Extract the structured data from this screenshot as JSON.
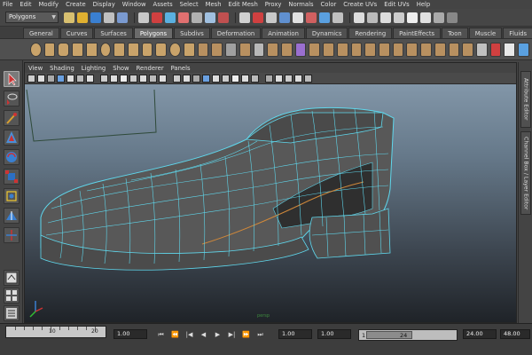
{
  "menu": [
    "File",
    "Edit",
    "Modify",
    "Create",
    "Display",
    "Window",
    "Assets",
    "Select",
    "Mesh",
    "Edit Mesh",
    "Proxy",
    "Normals",
    "Color",
    "Create UVs",
    "Edit UVs",
    "Help"
  ],
  "status_line": {
    "mode_value": "Polygons"
  },
  "shelf_tabs": [
    "General",
    "Curves",
    "Surfaces",
    "Polygons",
    "Subdivs",
    "Deformation",
    "Animation",
    "Dynamics",
    "Rendering",
    "PaintEffects",
    "Toon",
    "Muscle",
    "Fluids",
    "Fur"
  ],
  "active_shelf_tab": "Polygons",
  "panel_menu": [
    "View",
    "Shading",
    "Lighting",
    "Show",
    "Renderer",
    "Panels"
  ],
  "side_tabs": [
    "Attribute Editor",
    "Channel Box / Layer Editor"
  ],
  "viewport": {
    "camera_label": "persp",
    "model": "shoe-mesh",
    "wire_color": "#5fd7ec",
    "surface_color": "#5a5a5a"
  },
  "time": {
    "tick_labels": [
      "10",
      "20"
    ],
    "start_field": "1.00",
    "current_field": "1.00",
    "range_start_field": "1.00",
    "range_start": "1",
    "range_end": "24",
    "end_field": "24.00",
    "playback_end": "48.00"
  },
  "colors": {
    "accent": "#5fd7ec",
    "panel_bg": "#444444"
  }
}
